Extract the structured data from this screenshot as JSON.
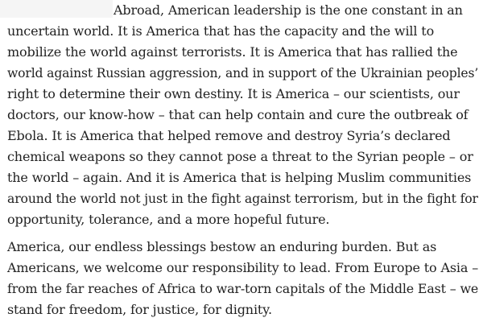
{
  "paragraph_1": {
    "lines": [
      "Abroad, American leadership is the one constant in an",
      "uncertain world. It is America that has the capacity and the will to",
      "mobilize the world against terrorists. It is America that has rallied the",
      "world against Russian aggression, and in support of the Ukrainian peoples’",
      "right to determine their own destiny. It is America – our scientists, our",
      "doctors, our know-how – that can help contain and cure the outbreak of",
      "Ebola. It is America that helped remove and destroy Syria’s declared",
      "chemical weapons so they cannot pose a threat to the Syrian people – or",
      "the world – again. And it is America that is helping Muslim communities",
      "around the world not just in the fight against terrorism, but in the fight for",
      "opportunity, tolerance, and a more hopeful future."
    ]
  },
  "paragraph_2": {
    "lines": [
      "America, our endless blessings bestow an enduring burden. But as",
      "Americans, we welcome our responsibility to lead. From Europe to Asia –",
      "from the far reaches of Africa to war-torn capitals of the Middle East – we",
      "stand for freedom, for justice, for dignity."
    ]
  }
}
